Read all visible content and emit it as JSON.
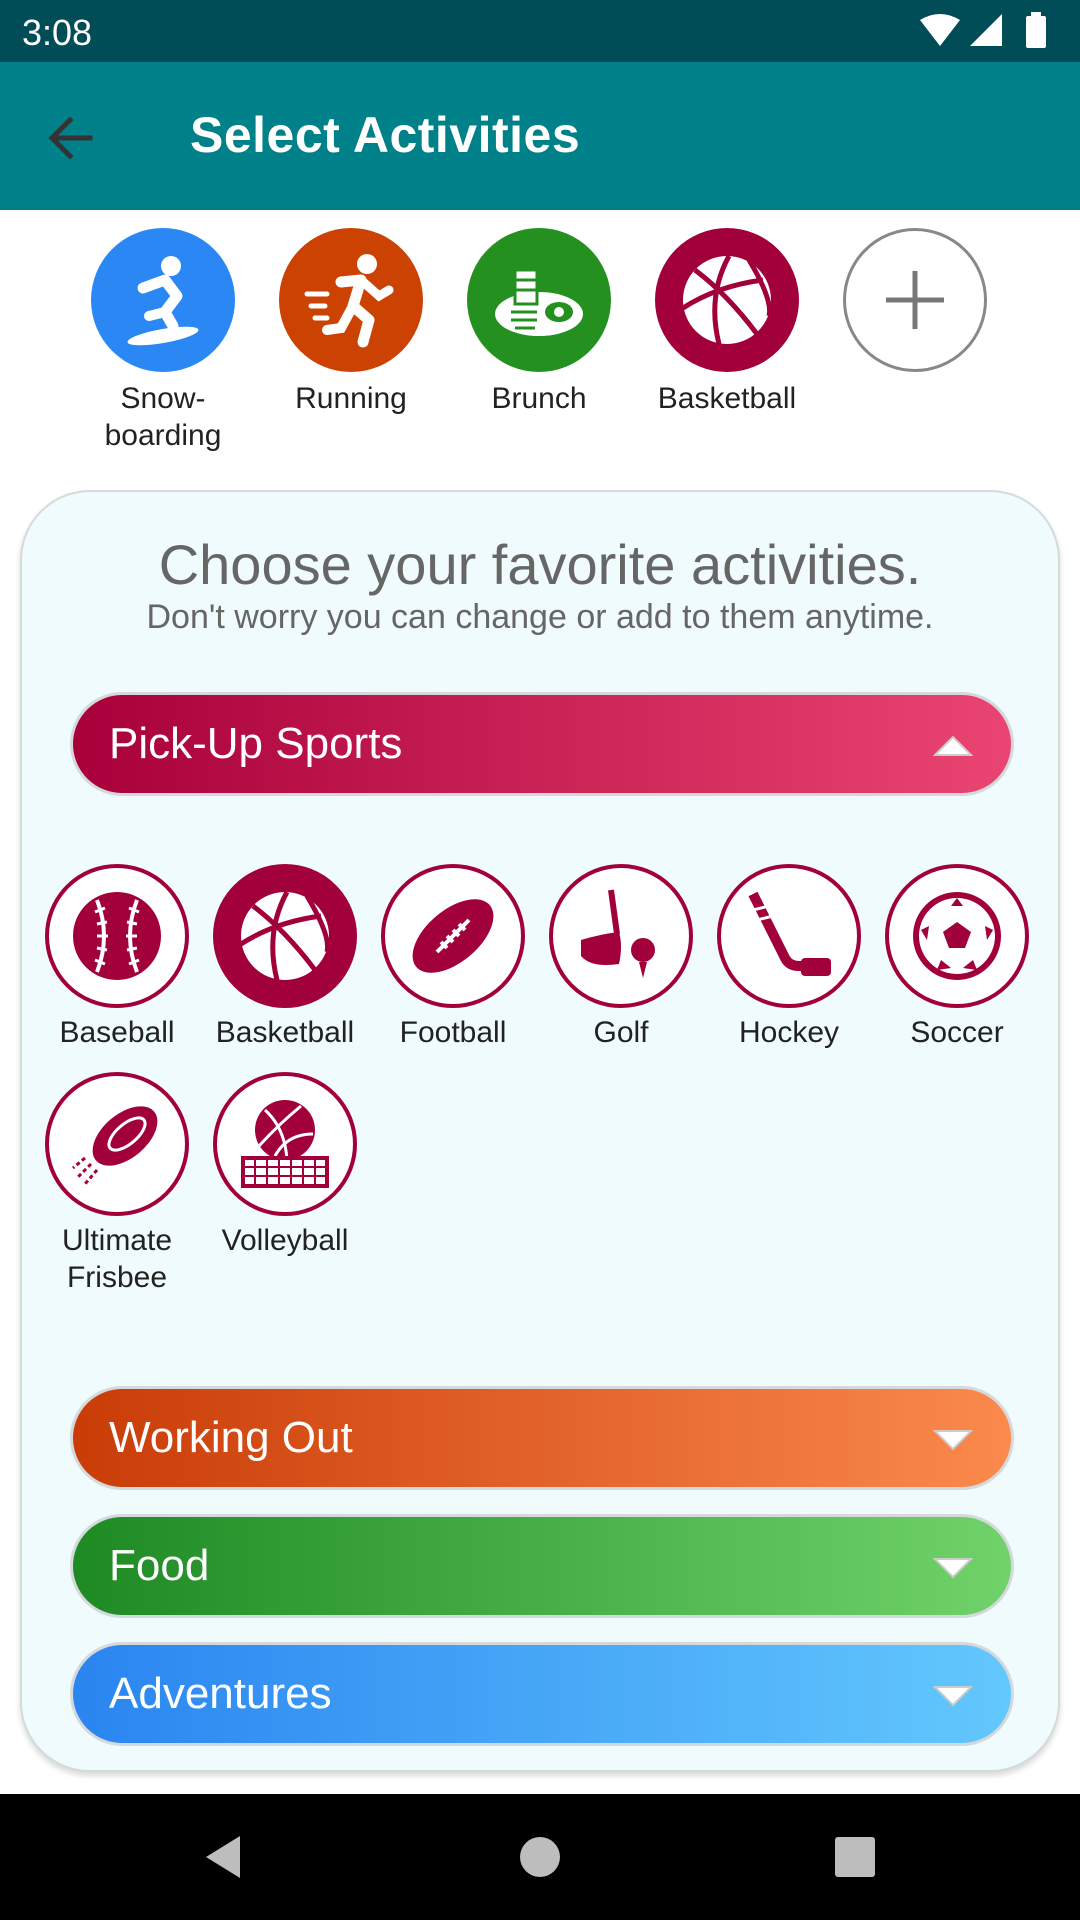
{
  "status_bar": {
    "time": "3:08"
  },
  "app_bar": {
    "title": "Select Activities"
  },
  "selected": [
    {
      "label_lines": [
        "Snow-",
        "boarding"
      ],
      "color": "#2b87f4",
      "icon": "snowboard-icon"
    },
    {
      "label_lines": [
        "Running"
      ],
      "color": "#cc4203",
      "icon": "running-icon"
    },
    {
      "label_lines": [
        "Brunch"
      ],
      "color": "#23901f",
      "icon": "brunch-icon"
    },
    {
      "label_lines": [
        "Basketball"
      ],
      "color": "#a1003b",
      "icon": "basketball-icon"
    }
  ],
  "card": {
    "title": "Choose your favorite activities.",
    "subtitle": "Don't worry you can change or add to them anytime."
  },
  "categories": [
    {
      "label": "Pick-Up Sports",
      "expanded": true
    },
    {
      "label": "Working Out",
      "expanded": false
    },
    {
      "label": "Food",
      "expanded": false
    },
    {
      "label": "Adventures",
      "expanded": false
    }
  ],
  "sports": [
    {
      "label_lines": [
        "Baseball"
      ],
      "selected": false,
      "icon": "baseball-icon"
    },
    {
      "label_lines": [
        "Basketball"
      ],
      "selected": true,
      "icon": "basketball-icon"
    },
    {
      "label_lines": [
        "Football"
      ],
      "selected": false,
      "icon": "football-icon"
    },
    {
      "label_lines": [
        "Golf"
      ],
      "selected": false,
      "icon": "golf-icon"
    },
    {
      "label_lines": [
        "Hockey"
      ],
      "selected": false,
      "icon": "hockey-icon"
    },
    {
      "label_lines": [
        "Soccer"
      ],
      "selected": false,
      "icon": "soccer-icon"
    },
    {
      "label_lines": [
        "Ultimate",
        "Frisbee"
      ],
      "selected": false,
      "icon": "frisbee-icon"
    },
    {
      "label_lines": [
        "Volleyball"
      ],
      "selected": false,
      "icon": "volleyball-icon"
    }
  ],
  "colors": {
    "accent": "#00818a",
    "sports": "#a1003b",
    "workout": "#cc4203",
    "food": "#23901f",
    "adventures": "#2b87f4"
  }
}
